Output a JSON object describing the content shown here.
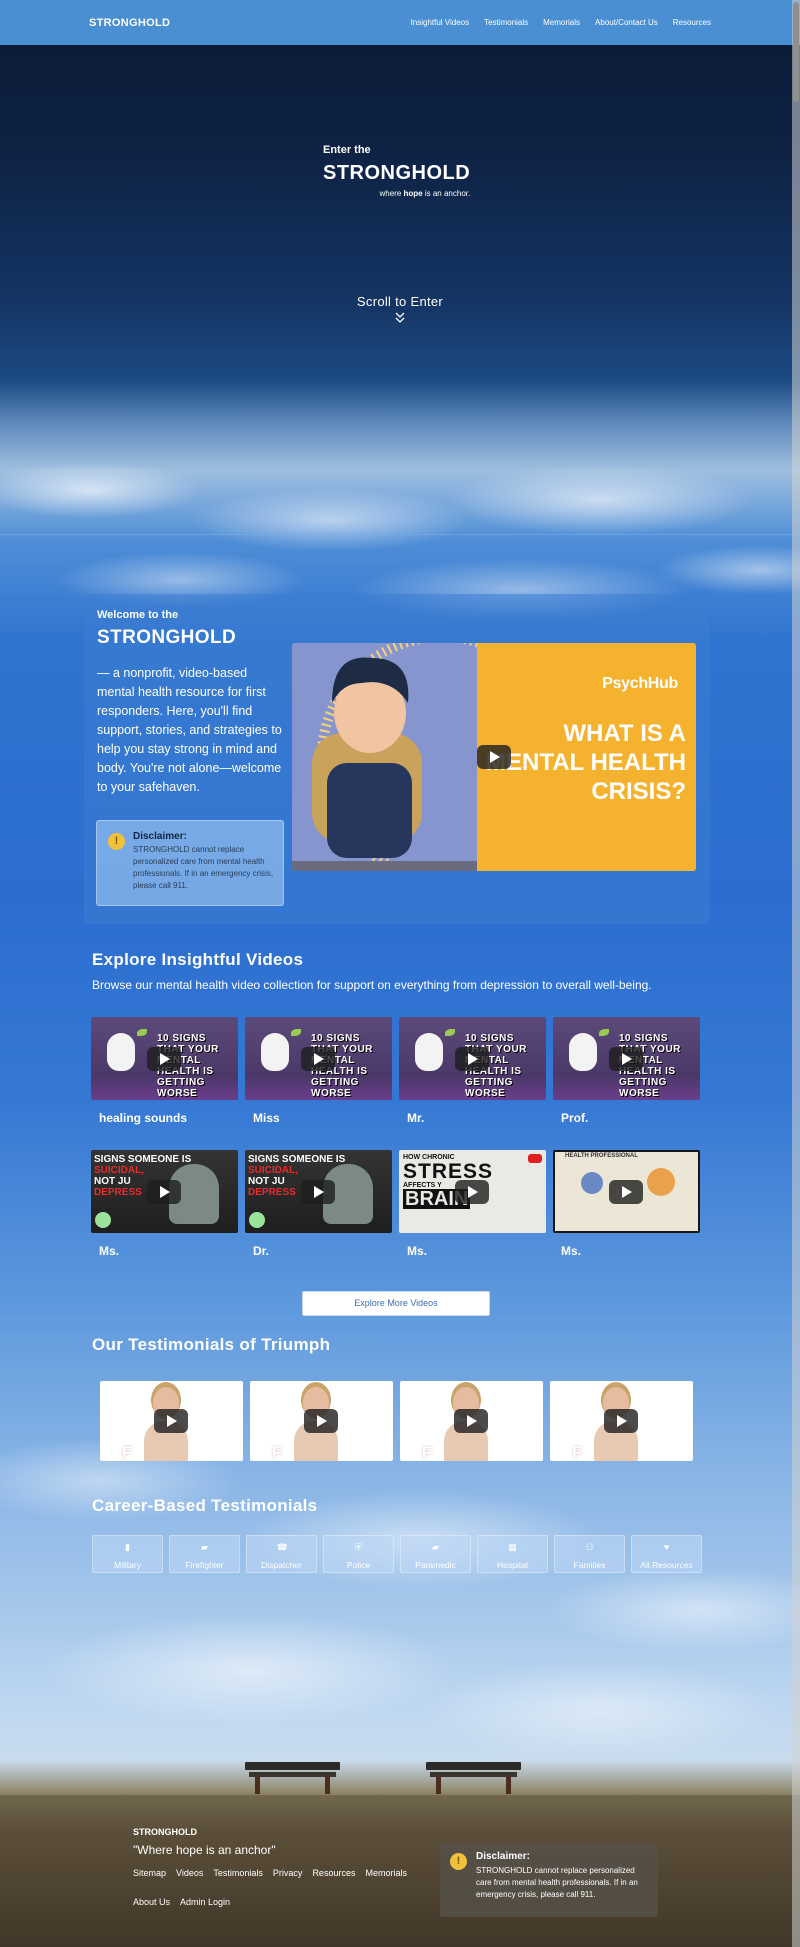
{
  "nav": {
    "brand": "STRONGHOLD",
    "links": [
      "Insightful Videos",
      "Testimonials",
      "Memorials",
      "About/Contact Us",
      "Resources"
    ]
  },
  "hero": {
    "eyebrow": "Enter the",
    "title": "STRONGHOLD",
    "tagline_pre": "where ",
    "tagline_bold": "hope",
    "tagline_post": " is an anchor.",
    "scroll_label": "Scroll to Enter"
  },
  "welcome": {
    "eyebrow": "Welcome to the",
    "title": "STRONGHOLD",
    "body": "— a nonprofit, video-based mental health resource for first responders. Here, you'll find support, stories, and strategies to help you stay strong in mind and body. You're not alone—welcome to your safehaven.",
    "disclaimer_title": "Disclaimer:",
    "disclaimer_text": "STRONGHOLD cannot replace personalized care from mental health professionals. If in an emergency crisis, please call 911.",
    "feature_video": {
      "brand": "PsychHub",
      "caption": "WHAT IS A MENTAL HEALTH CRISIS?"
    }
  },
  "explore": {
    "title": "Explore Insightful Videos",
    "description": "Browse our mental health video collection for support on everything from depression to overall well-being.",
    "row1": [
      {
        "label": "healing sounds",
        "thumb_text": "10 SIGNS THAT YOUR MENTAL HEALTH IS GETTING WORSE"
      },
      {
        "label": "Miss",
        "thumb_text": "10 SIGNS THAT YOUR MENTAL HEALTH IS GETTING WORSE"
      },
      {
        "label": "Mr.",
        "thumb_text": "10 SIGNS THAT YOUR MENTAL HEALTH IS GETTING WORSE"
      },
      {
        "label": "Prof.",
        "thumb_text": "10 SIGNS THAT YOUR MENTAL HEALTH IS GETTING WORSE"
      }
    ],
    "row2": [
      {
        "label": "Ms.",
        "thumb_text_1": "SIGNS SOMEONE IS",
        "thumb_text_red": "SUICIDAL,",
        "thumb_text_2": "NOT JU",
        "thumb_text_red2": "DEPRESS"
      },
      {
        "label": "Dr.",
        "thumb_text_1": "SIGNS SOMEONE IS",
        "thumb_text_red": "SUICIDAL,",
        "thumb_text_2": "NOT JU",
        "thumb_text_red2": "DEPRESS"
      },
      {
        "label": "Ms.",
        "r1": "HOW CHRONIC",
        "r2": "STRESS",
        "r3": "AFFECTS Y",
        "r4": "BRAIN"
      },
      {
        "label": "Ms.",
        "thumb_text": "HEALTH PROFESSIONAL"
      }
    ],
    "button": "Explore More Videos"
  },
  "testimonials": {
    "title": "Our Testimonials of Triumph",
    "count_shown": 4
  },
  "career": {
    "title": "Career-Based Testimonials",
    "items": [
      {
        "label": "Military",
        "icon": "id-badge-icon"
      },
      {
        "label": "Firefighter",
        "icon": "fire-truck-icon"
      },
      {
        "label": "Dispatcher",
        "icon": "phone-icon"
      },
      {
        "label": "Police",
        "icon": "shield-icon"
      },
      {
        "label": "Paramedic",
        "icon": "ambulance-icon"
      },
      {
        "label": "Hospital",
        "icon": "hospital-icon"
      },
      {
        "label": "Families",
        "icon": "family-icon"
      },
      {
        "label": "All Resources",
        "icon": "heart-icon"
      }
    ]
  },
  "footer": {
    "brand": "STRONGHOLD",
    "tagline": "\"Where hope is an anchor\"",
    "links": [
      "Sitemap",
      "Videos",
      "Testimonials",
      "Privacy",
      "Resources",
      "Memorials"
    ],
    "links2": [
      "About Us",
      "Admin Login"
    ],
    "disclaimer_title": "Disclaimer:",
    "disclaimer_text": "STRONGHOLD cannot replace personalized care from mental health professionals. If in an emergency crisis, please call 911."
  },
  "colors": {
    "nav": "#4a8fd2",
    "accent": "#3a6db5",
    "warning": "#f0c13a"
  }
}
